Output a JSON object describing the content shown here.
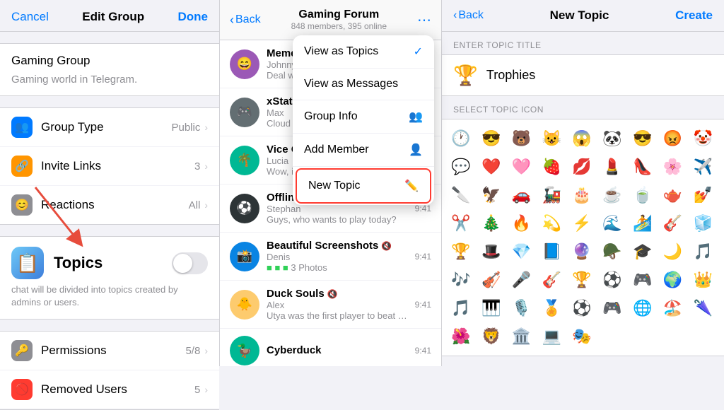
{
  "panel1": {
    "header": {
      "cancel_label": "Cancel",
      "title": "Edit Group",
      "done_label": "Done"
    },
    "group_name": "Gaming Group",
    "group_desc": "Gaming world in Telegram.",
    "rows": [
      {
        "label": "Group Type",
        "value": "Public",
        "icon": "👥",
        "icon_color": "icon-blue"
      },
      {
        "label": "Invite Links",
        "value": "3",
        "icon": "🔗",
        "icon_color": "icon-orange"
      },
      {
        "label": "Reactions",
        "value": "All",
        "icon": "🎭",
        "icon_color": "icon-gray"
      }
    ],
    "topics": {
      "label": "Topics",
      "desc": "chat will be divided into topics created by admins or users."
    },
    "permissions": {
      "label": "Permissions",
      "value": "5/8"
    },
    "removed_users": {
      "label": "Removed Users",
      "value": "5"
    }
  },
  "panel2": {
    "header": {
      "back_label": "Back",
      "title": "Gaming Forum",
      "subtitle": "848 members, 395 online"
    },
    "dropdown": {
      "items": [
        {
          "label": "View as Topics",
          "icon": "✓",
          "checked": true
        },
        {
          "label": "View as Messages",
          "icon": "",
          "checked": false
        },
        {
          "label": "Group Info",
          "icon": "👥",
          "checked": false
        },
        {
          "label": "Add Member",
          "icon": "👤+",
          "checked": false
        },
        {
          "label": "New Topic",
          "icon": "✏️",
          "checked": false,
          "highlighted": true
        }
      ]
    },
    "topics": [
      {
        "name": "Memes",
        "sub": "Johnny",
        "msg": "Deal with it.",
        "time": "",
        "avatar_emoji": "😄",
        "avatar_color": "avatar-purple"
      },
      {
        "name": "xStation",
        "sub": "Max",
        "msg": "Cloud gaming? So...",
        "time": "",
        "avatar_emoji": "🎮",
        "avatar_color": "avatar-gray"
      },
      {
        "name": "Vice City",
        "sub": "Lucia",
        "msg": "Wow, it's going to...",
        "time": "",
        "avatar_emoji": "🌴",
        "avatar_color": "avatar-teal"
      },
      {
        "name": "Offline Fifa",
        "sub": "Stephan",
        "msg": "Guys, who wants to play today?",
        "time": "9:41",
        "avatar_emoji": "⚽",
        "avatar_color": "avatar-dark"
      },
      {
        "name": "Beautiful Screenshots",
        "sub": "Denis",
        "msg": "3 Photos",
        "time": "9:41",
        "avatar_emoji": "📸",
        "avatar_color": "avatar-blue"
      },
      {
        "name": "Duck Souls",
        "sub": "Alex",
        "msg": "Utya was the first player to beat Duck Souls...",
        "time": "9:41",
        "avatar_emoji": "🐥",
        "avatar_color": "avatar-yellow"
      },
      {
        "name": "Cyberduck",
        "sub": "",
        "msg": "",
        "time": "9:41",
        "avatar_emoji": "🦆",
        "avatar_color": "avatar-teal"
      }
    ]
  },
  "panel3": {
    "header": {
      "back_label": "Back",
      "title": "New Topic",
      "create_label": "Create"
    },
    "enter_topic_label": "ENTER TOPIC TITLE",
    "topic_title": "Trophies",
    "select_icon_label": "SELECT TOPIC ICON",
    "emojis": [
      "🕐",
      "😎",
      "🐻",
      "😺",
      "😱",
      "🐼",
      "😎",
      "😡",
      "🤡",
      "💬",
      "❤️",
      "🩷",
      "🍓",
      "💋",
      "💄",
      "👠",
      "🌸",
      "✈️",
      "🔪",
      "🦅",
      "🚗",
      "🚂",
      "🎂",
      "☕",
      "🍵",
      "🫖",
      "💅",
      "✂️",
      "🎄",
      "🔥",
      "💫",
      "⚡",
      "🌊",
      "🏄",
      "🎸",
      "🧊",
      "🏆",
      "🎩",
      "💎",
      "📘",
      "🔮",
      "🪖",
      "🎓",
      "🌙",
      "🎵",
      "🎶",
      "🎻",
      "🎤",
      "🎸",
      "🏆",
      "⚽",
      "🎮",
      "🌍",
      "👑",
      "🎵",
      "🎹",
      "🎙️",
      "🏅",
      "⚽",
      "🎮",
      "🌐",
      "🏖️",
      "🌂",
      "🌺",
      "🦁",
      "🏛️",
      "💻",
      "🎭"
    ]
  }
}
